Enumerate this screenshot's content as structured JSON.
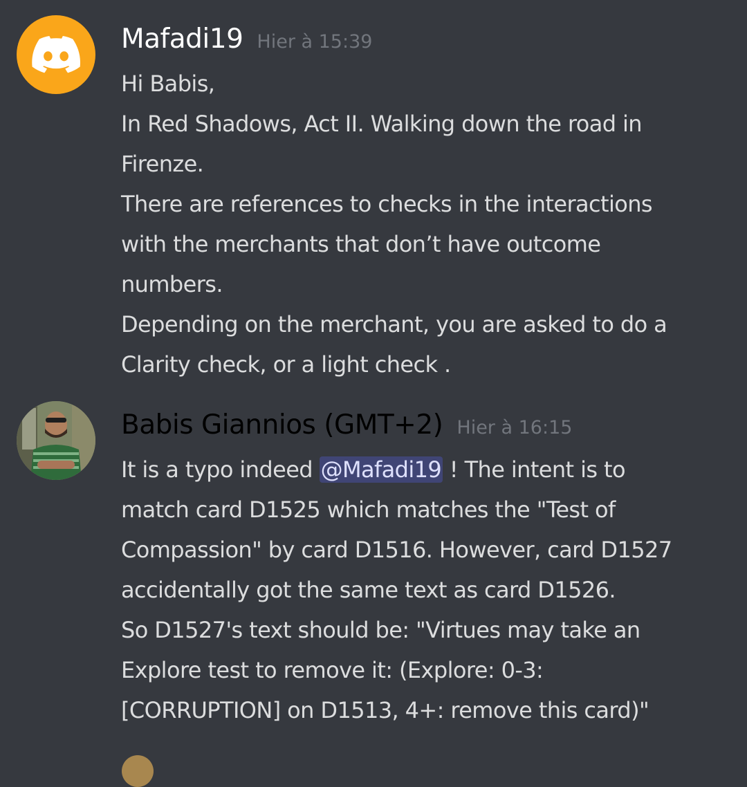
{
  "messages": [
    {
      "username": "Mafadi19",
      "timestamp": "Hier à 15:39",
      "username_color": "#ffffff",
      "avatar": "discord-logo-icon",
      "lines": [
        "Hi Babis,",
        "In Red Shadows, Act II. Walking down the road in",
        "Firenze.",
        "There are references to checks in the interactions",
        "with the merchants that don’t have outcome",
        "numbers.",
        "Depending on the merchant, you are asked to do a",
        "Clarity check, or a light check ."
      ]
    },
    {
      "username": "Babis Giannios (GMT+2)",
      "timestamp": "Hier à 16:15",
      "username_color": "#000000",
      "avatar": "user-photo-avatar",
      "first_line_before": "It is a typo indeed ",
      "mention": "@Mafadi19",
      "first_line_after": " ! The intent is to",
      "lines": [
        "match card D1525 which matches the \"Test of",
        "Compassion\" by card D1516. However, card D1527",
        "accidentally got the same text as card D1526.",
        "So D1527's text should be: \"Virtues may take an",
        "Explore test to remove it: (Explore: 0-3:",
        "[CORRUPTION] on D1513, 4+: remove this card)\""
      ]
    }
  ],
  "colors": {
    "background": "#36393f",
    "text": "#dcddde",
    "timestamp": "#72767d",
    "discord_avatar_bg": "#faa61a",
    "mention_bg": "rgba(88,101,242,0.3)"
  }
}
